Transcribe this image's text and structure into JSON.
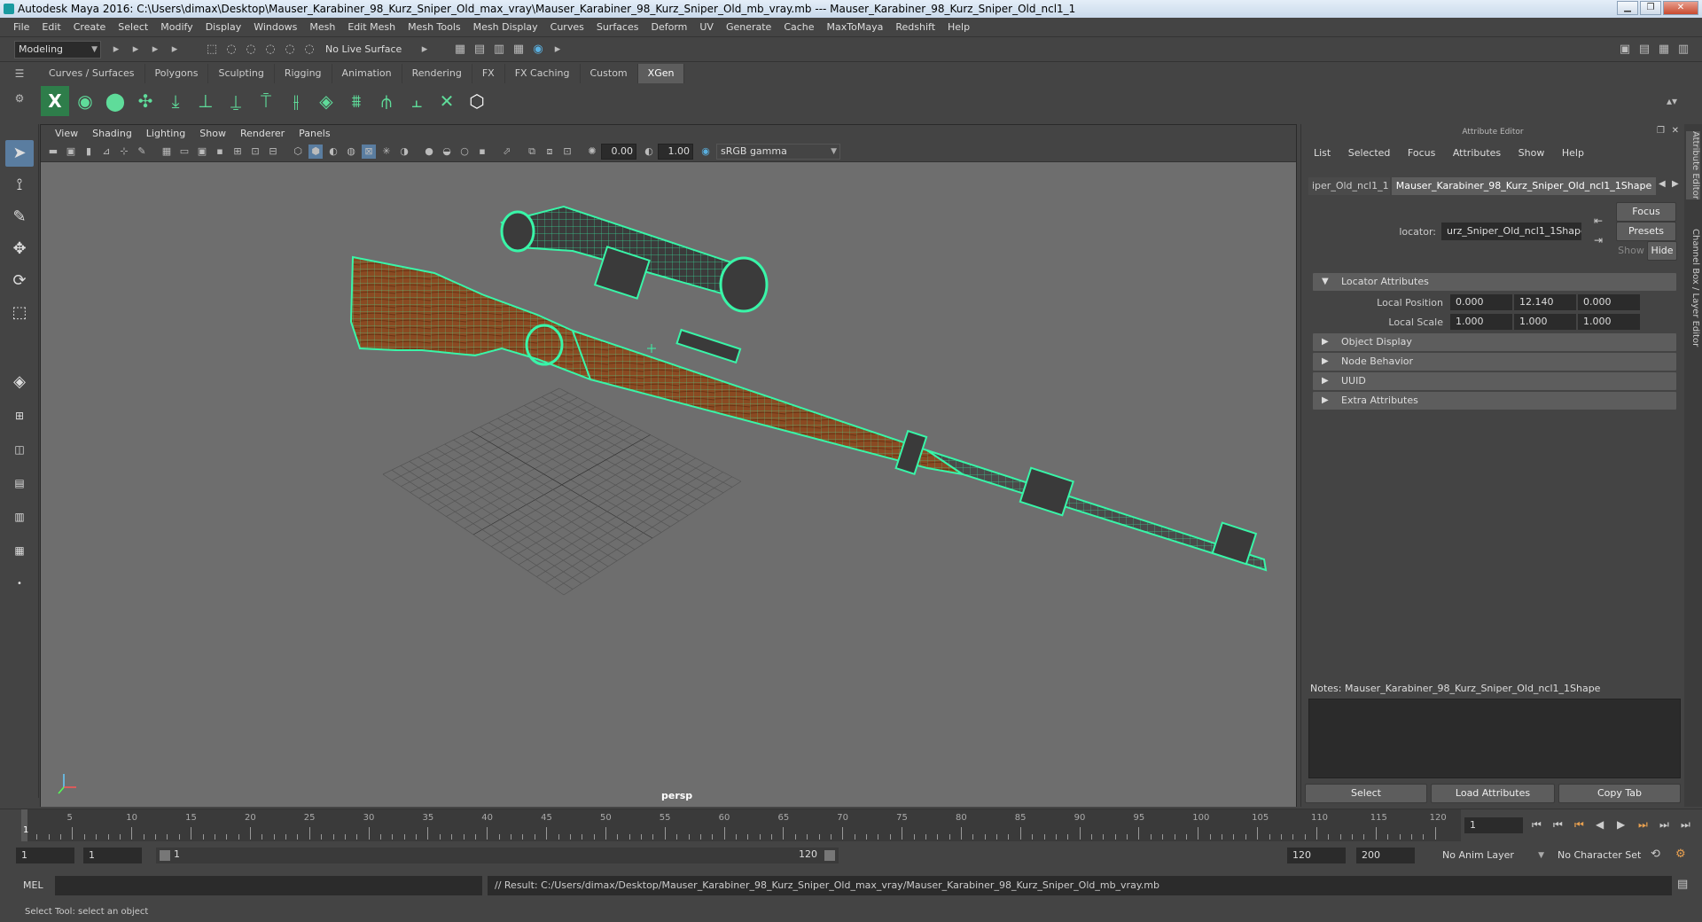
{
  "window": {
    "title": "Autodesk Maya 2016: C:\\Users\\dimax\\Desktop\\Mauser_Karabiner_98_Kurz_Sniper_Old_max_vray\\Mauser_Karabiner_98_Kurz_Sniper_Old_mb_vray.mb   ---   Mauser_Karabiner_98_Kurz_Sniper_Old_ncl1_1"
  },
  "menubar": [
    "File",
    "Edit",
    "Create",
    "Select",
    "Modify",
    "Display",
    "Windows",
    "Mesh",
    "Edit Mesh",
    "Mesh Tools",
    "Mesh Display",
    "Curves",
    "Surfaces",
    "Deform",
    "UV",
    "Generate",
    "Cache",
    "MaxToMaya",
    "Redshift",
    "Help"
  ],
  "statusline": {
    "mode": "Modeling",
    "live_surface": "No Live Surface"
  },
  "shelf_tabs": [
    "Curves / Surfaces",
    "Polygons",
    "Sculpting",
    "Rigging",
    "Animation",
    "Rendering",
    "FX",
    "FX Caching",
    "Custom",
    "XGen"
  ],
  "shelf_active": "XGen",
  "viewport": {
    "menu": [
      "View",
      "Shading",
      "Lighting",
      "Show",
      "Renderer",
      "Panels"
    ],
    "exposure": "0.00",
    "gamma": "1.00",
    "color_space": "sRGB gamma",
    "camera": "persp"
  },
  "attribute_editor": {
    "header": "Attribute Editor",
    "menu": [
      "List",
      "Selected",
      "Focus",
      "Attributes",
      "Show",
      "Help"
    ],
    "tab_prev": "iper_Old_ncl1_1",
    "tab_active": "Mauser_Karabiner_98_Kurz_Sniper_Old_ncl1_1Shape",
    "locator_label": "locator:",
    "locator_value": "urz_Sniper_Old_ncl1_1Shape",
    "focus_btn": "Focus",
    "presets_btn": "Presets",
    "show_btn": "Show",
    "hide_btn": "Hide",
    "sections": {
      "locator": "Locator Attributes",
      "object_display": "Object Display",
      "node_behavior": "Node Behavior",
      "uuid": "UUID",
      "extra": "Extra Attributes"
    },
    "local_position_label": "Local Position",
    "local_position": [
      "0.000",
      "12.140",
      "0.000"
    ],
    "local_scale_label": "Local Scale",
    "local_scale": [
      "1.000",
      "1.000",
      "1.000"
    ],
    "notes": "Notes:  Mauser_Karabiner_98_Kurz_Sniper_Old_ncl1_1Shape",
    "select_btn": "Select",
    "load_btn": "Load Attributes",
    "copy_btn": "Copy Tab"
  },
  "side_tabs": [
    "Attribute Editor",
    "Channel Box / Layer Editor"
  ],
  "timeline": {
    "ticks": [
      "5",
      "10",
      "15",
      "20",
      "25",
      "30",
      "35",
      "40",
      "45",
      "50",
      "55",
      "60",
      "65",
      "70",
      "75",
      "80",
      "85",
      "90",
      "95",
      "100",
      "105",
      "110",
      "115",
      "120"
    ],
    "start_marker": "1",
    "current_frame": "1"
  },
  "range": {
    "start": "1",
    "playback_start": "1",
    "slider_start": "1",
    "slider_end": "120",
    "playback_end": "120",
    "end": "200",
    "anim_layer": "No Anim Layer",
    "char_set": "No Character Set"
  },
  "cmdline": {
    "lang": "MEL",
    "result": "// Result: C:/Users/dimax/Desktop/Mauser_Karabiner_98_Kurz_Sniper_Old_max_vray/Mauser_Karabiner_98_Kurz_Sniper_Old_mb_vray.mb"
  },
  "helpline": "Select Tool: select an object",
  "colors": {
    "wire": "#39f5a8",
    "wood": "#8a4a22",
    "panel": "#444444",
    "viewport_bg": "#6e6e6e"
  }
}
